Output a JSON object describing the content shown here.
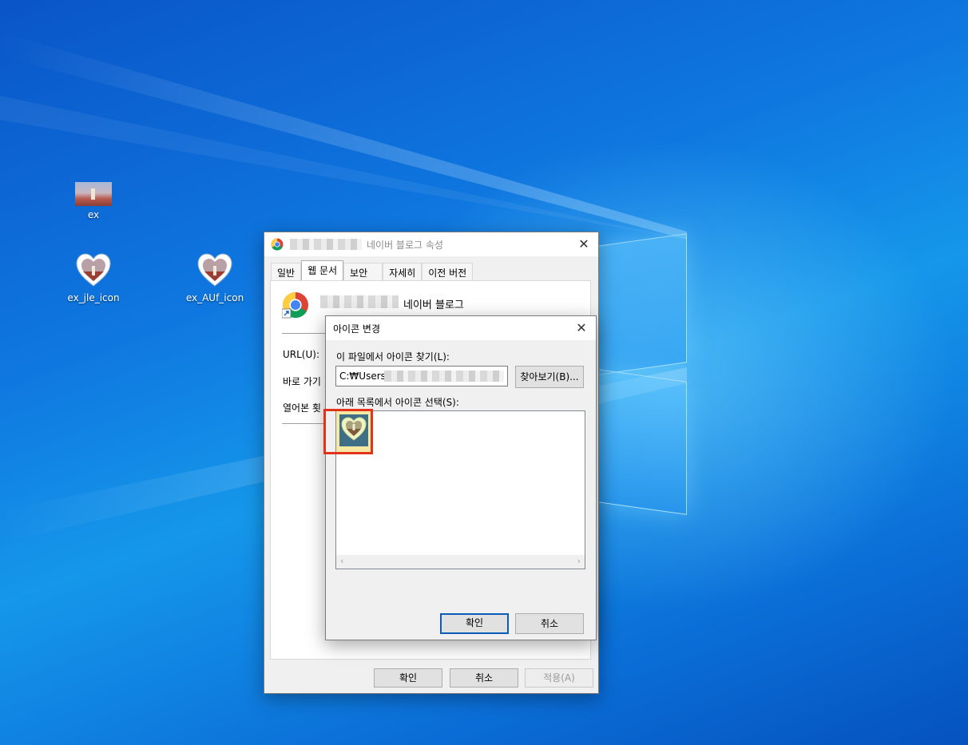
{
  "desktop": {
    "icons": [
      {
        "label": "ex"
      },
      {
        "label": "ex_jle_icon"
      },
      {
        "label": "ex_AUf_icon"
      }
    ]
  },
  "properties_dialog": {
    "title": "네이버 블로그 속성",
    "tabs": [
      "일반",
      "웹 문서",
      "보안",
      "자세히",
      "이전 버전"
    ],
    "active_tab": "웹 문서",
    "shortcut_name": "네이버 블로그",
    "fields": {
      "url_label": "URL(U):",
      "shortcut_key_label": "바로 가기",
      "visits_label": "열어본 횟"
    },
    "buttons": {
      "ok": "확인",
      "cancel": "취소",
      "apply": "적용(A)"
    }
  },
  "change_icon_dialog": {
    "title": "아이콘 변경",
    "find_label": "이 파일에서 아이콘 찾기(L):",
    "path_value": "C:₩Users",
    "browse_label": "찾아보기(B)...",
    "select_label": "아래 목록에서 아이콘 선택(S):",
    "buttons": {
      "ok": "확인",
      "cancel": "취소"
    }
  },
  "colors": {
    "desktop_blue": "#0f78e0",
    "highlight_red": "#e2331a",
    "selection_yellow": "#f6e7a3",
    "default_button_border": "#0b5bb8"
  }
}
